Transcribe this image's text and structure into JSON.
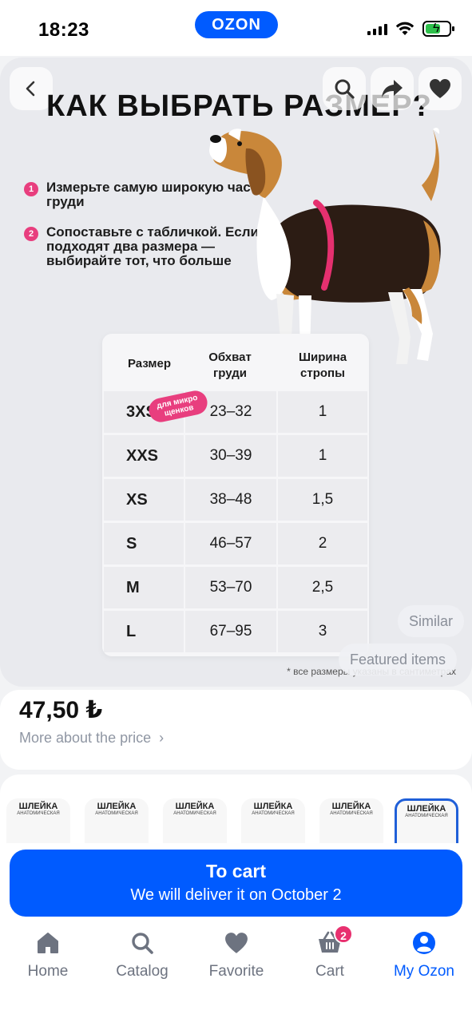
{
  "status": {
    "time": "18:23",
    "app_logo": "OZON"
  },
  "product_image": {
    "headline": "КАК ВЫБРАТЬ РАЗМЕР?",
    "steps": [
      {
        "num": "1",
        "text": "Измерьте самую широкую часть груди"
      },
      {
        "num": "2",
        "text": "Сопоставьте с табличкой. Если подходят два размера — выбирайте тот, что больше"
      }
    ],
    "table": {
      "headers": [
        "Размер",
        "Обхват груди",
        "Ширина стропы"
      ],
      "rows": [
        {
          "size": "3XS",
          "chest": "23–32",
          "strap": "1"
        },
        {
          "size": "XXS",
          "chest": "30–39",
          "strap": "1"
        },
        {
          "size": "XS",
          "chest": "38–48",
          "strap": "1,5"
        },
        {
          "size": "S",
          "chest": "46–57",
          "strap": "2"
        },
        {
          "size": "M",
          "chest": "53–70",
          "strap": "2,5"
        },
        {
          "size": "L",
          "chest": "67–95",
          "strap": "3"
        }
      ],
      "tag": "для микро щенков",
      "footnote": "* все размеры указаны в сантиметрах"
    },
    "chips": {
      "similar": "Similar",
      "featured": "Featured items"
    },
    "icons": {
      "back": "chevron-left-icon",
      "search": "search-icon",
      "share": "share-icon",
      "favorite": "heart-icon"
    }
  },
  "price": {
    "value": "47,50 ₺",
    "more": "More about the price"
  },
  "variants": [
    {
      "title": "ШЛЕЙКА",
      "sub": "АНАТОМИЧЕСКАЯ"
    },
    {
      "title": "ШЛЕЙКА",
      "sub": "АНАТОМИЧЕСКАЯ"
    },
    {
      "title": "ШЛЕЙКА",
      "sub": "АНАТОМИЧЕСКАЯ"
    },
    {
      "title": "ШЛЕЙКА",
      "sub": "АНАТОМИЧЕСКАЯ"
    },
    {
      "title": "ШЛЕЙКА",
      "sub": "АНАТОМИЧЕСКАЯ"
    },
    {
      "title": "ШЛЕЙКА",
      "sub": "АНАТОМИЧЕСКАЯ"
    }
  ],
  "cart": {
    "title": "To cart",
    "subtitle": "We will deliver it on October 2"
  },
  "nav": {
    "items": [
      {
        "label": "Home",
        "icon": "home-icon"
      },
      {
        "label": "Catalog",
        "icon": "search-icon"
      },
      {
        "label": "Favorite",
        "icon": "heart-icon"
      },
      {
        "label": "Cart",
        "icon": "cart-icon",
        "badge": "2"
      },
      {
        "label": "My Ozon",
        "icon": "profile-icon"
      }
    ],
    "active": "My Ozon"
  },
  "colors": {
    "brand": "#005bff",
    "accent_pink": "#e83e7e",
    "badge": "#e8306f"
  }
}
